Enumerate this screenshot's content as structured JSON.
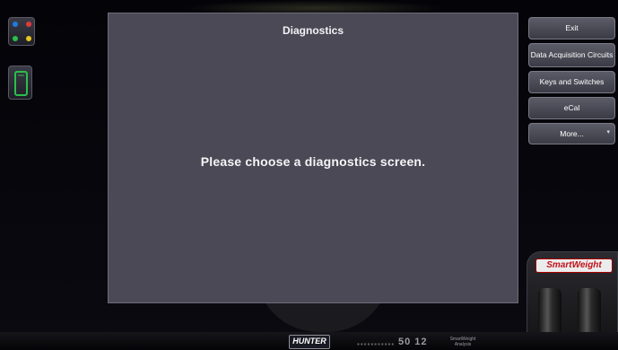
{
  "panel": {
    "title": "Diagnostics",
    "message": "Please choose a diagnostics screen."
  },
  "sidebar": {
    "buttons": [
      {
        "label": "Exit"
      },
      {
        "label": "Data Acquisition Circuits"
      },
      {
        "label": "Keys and Switches"
      },
      {
        "label": "eCal"
      },
      {
        "label": "More...",
        "has_dropdown": true
      }
    ]
  },
  "smartweight": {
    "logo": "SmartWeight"
  },
  "footer": {
    "brand": "HUNTER",
    "readout": "50 12",
    "sw_label": "SmartWeight Analysis"
  },
  "icons": [
    {
      "name": "vehicle-overview-icon"
    },
    {
      "name": "phone-device-icon"
    }
  ]
}
